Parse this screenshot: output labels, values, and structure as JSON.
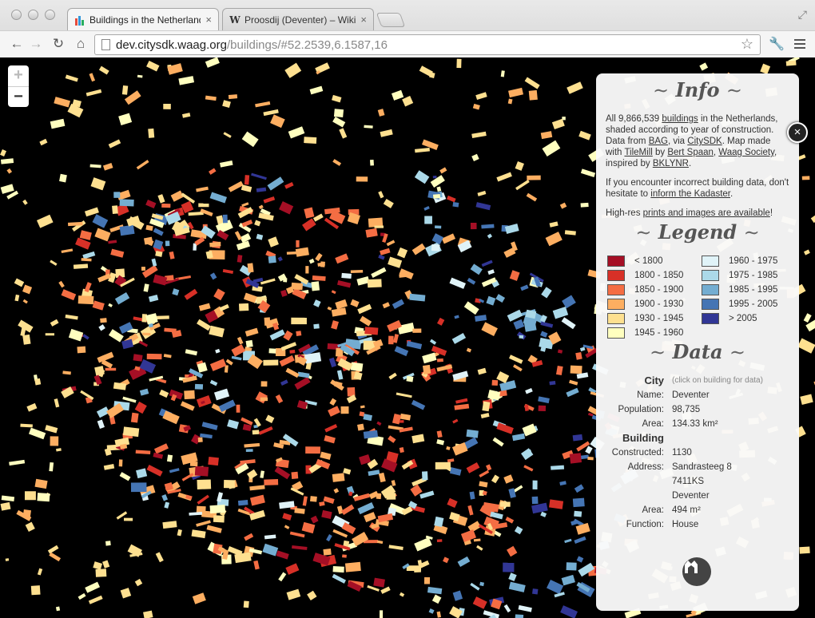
{
  "browser": {
    "tabs": [
      {
        "label": "Buildings in the Netherlands",
        "favicon": "bar-chart-favicon",
        "active": true
      },
      {
        "label": "Proosdij (Deventer) – Wikipedia",
        "favicon": "wikipedia-w",
        "active": false
      }
    ],
    "wiki_glyph": "W",
    "close_glyph": "×",
    "address": {
      "host": "dev.citysdk.waag.org",
      "path": "/buildings/#52.2539,6.1587,16"
    }
  },
  "map": {
    "zoom_in": "+",
    "zoom_out": "−",
    "close_panel": "×"
  },
  "info": {
    "heading": "Info",
    "intro": {
      "t1": "All 9,866,539 ",
      "l1": "buildings",
      "t2": " in the Netherlands, shaded according to year of construction. Data from ",
      "l2": "BAG",
      "t3": ", via ",
      "l3": "CitySDK",
      "t4": ". Map made with ",
      "l4": "TileMill",
      "t5": " by ",
      "l5": "Bert Spaan",
      "t6": ", ",
      "l6": "Waag Society",
      "t7": ", inspired by ",
      "l7": "BKLYNR",
      "t8": "."
    },
    "kadaster": {
      "t1": "If you encounter incorrect building data, don't hesitate to ",
      "l1": "inform the Kadaster",
      "t2": "."
    },
    "prints": {
      "t1": "High-res ",
      "l1": "prints and images are available",
      "t2": "!"
    }
  },
  "legend": {
    "heading": "Legend",
    "items": [
      {
        "label": "< 1800",
        "color": "#a50f25"
      },
      {
        "label": "1960 - 1975",
        "color": "#e0f3f8"
      },
      {
        "label": "1800 - 1850",
        "color": "#d73027"
      },
      {
        "label": "1975 - 1985",
        "color": "#abd9e9"
      },
      {
        "label": "1850 - 1900",
        "color": "#f46d43"
      },
      {
        "label": "1985 - 1995",
        "color": "#74add1"
      },
      {
        "label": "1900 - 1930",
        "color": "#fdae61"
      },
      {
        "label": "1995 - 2005",
        "color": "#4575b4"
      },
      {
        "label": "1930 - 1945",
        "color": "#fee090"
      },
      {
        "label": "> 2005",
        "color": "#313695"
      },
      {
        "label": "1945 - 1960",
        "color": "#ffffbf"
      }
    ]
  },
  "data": {
    "heading": "Data",
    "city_label": "City",
    "city_hint": "(click on building for data)",
    "name_k": "Name:",
    "name_v": "Deventer",
    "pop_k": "Population:",
    "pop_v": "98,735",
    "area_k": "Area:",
    "area_v": "134.33 km²",
    "building_label": "Building",
    "constructed_k": "Constructed:",
    "constructed_v": "1130",
    "address_k": "Address:",
    "address_1": "Sandrasteeg 8",
    "address_2": "7411KS",
    "address_3": "Deventer",
    "barea_k": "Area:",
    "barea_v": "494 m²",
    "function_k": "Function:",
    "function_v": "House"
  }
}
